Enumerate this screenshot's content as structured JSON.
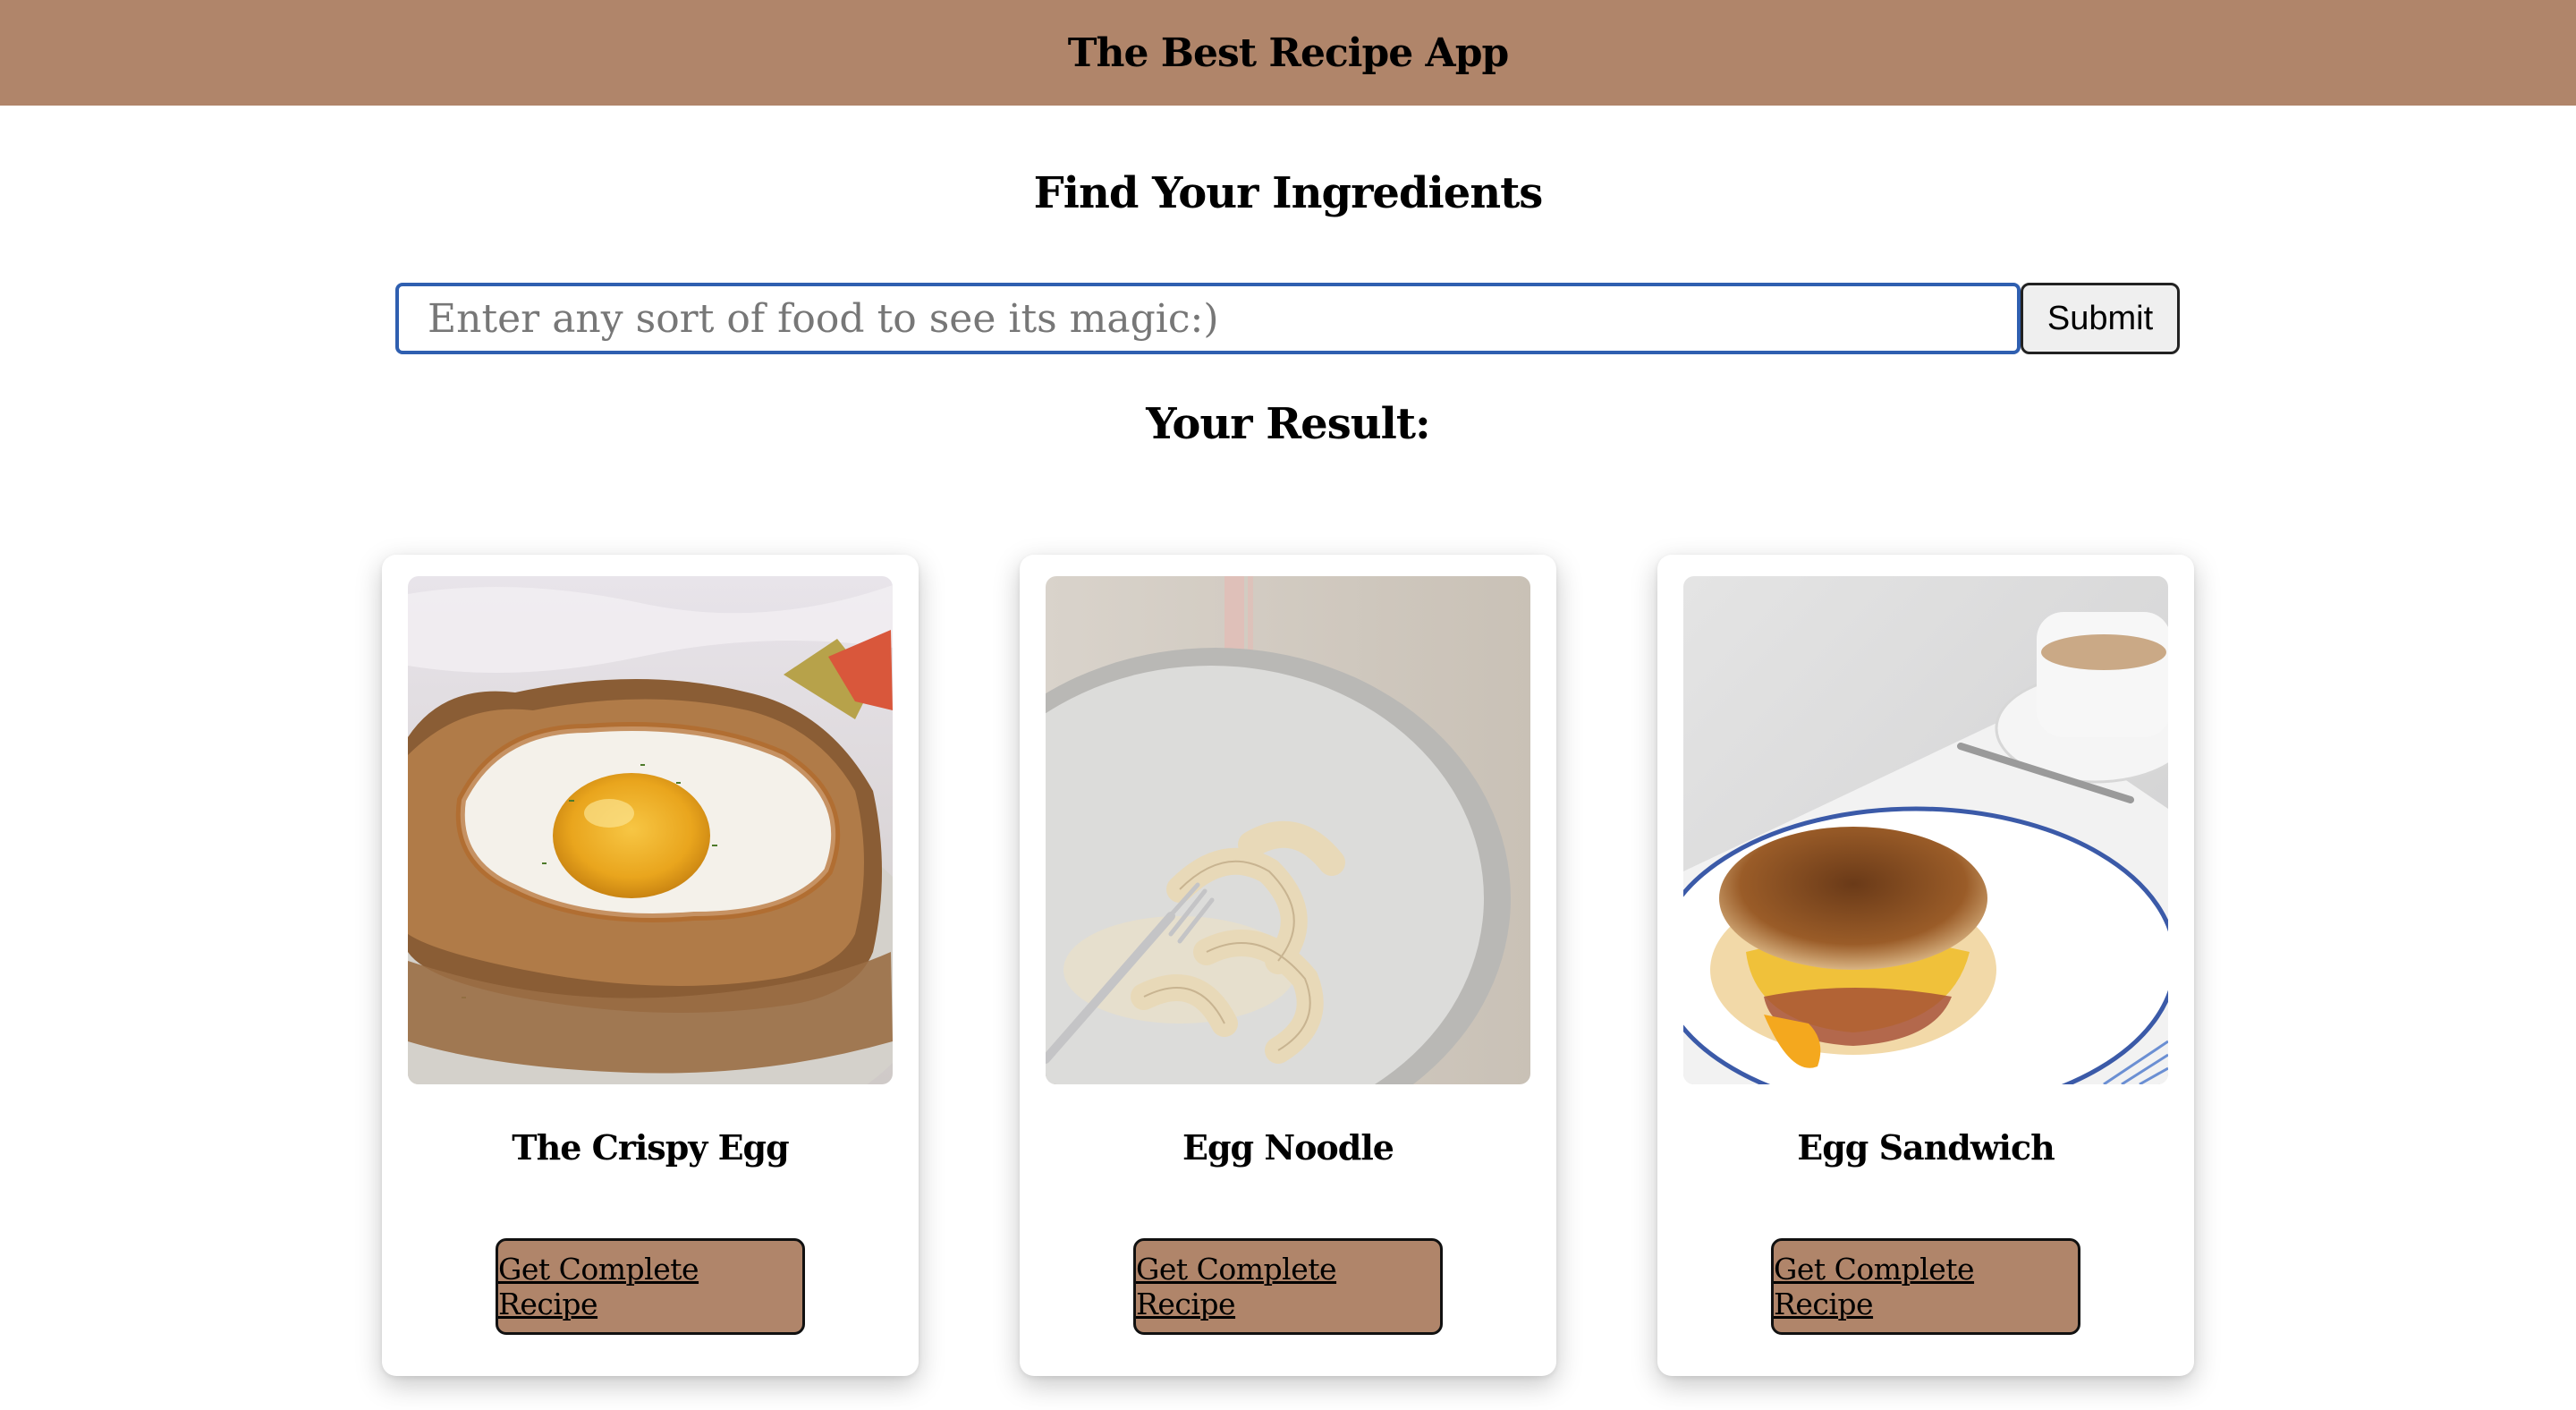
{
  "header": {
    "title": "The Best Recipe App"
  },
  "search": {
    "title": "Find Your Ingredients",
    "placeholder": "Enter any sort of food to see its magic:)",
    "value": "",
    "submit_label": "Submit"
  },
  "results": {
    "title": "Your Result:",
    "cards": [
      {
        "title": "The Crispy Egg",
        "button_label": "Get Complete Recipe",
        "image": "fried-egg-on-toast-photo"
      },
      {
        "title": "Egg Noodle",
        "button_label": "Get Complete Recipe",
        "image": "egg-noodles-on-plate-photo"
      },
      {
        "title": "Egg Sandwich",
        "button_label": "Get Complete Recipe",
        "image": "egg-muffin-sandwich-photo"
      }
    ]
  },
  "colors": {
    "header_bg": "#b0856a",
    "button_bg": "#b0856a",
    "input_border": "#2f5fb0"
  }
}
